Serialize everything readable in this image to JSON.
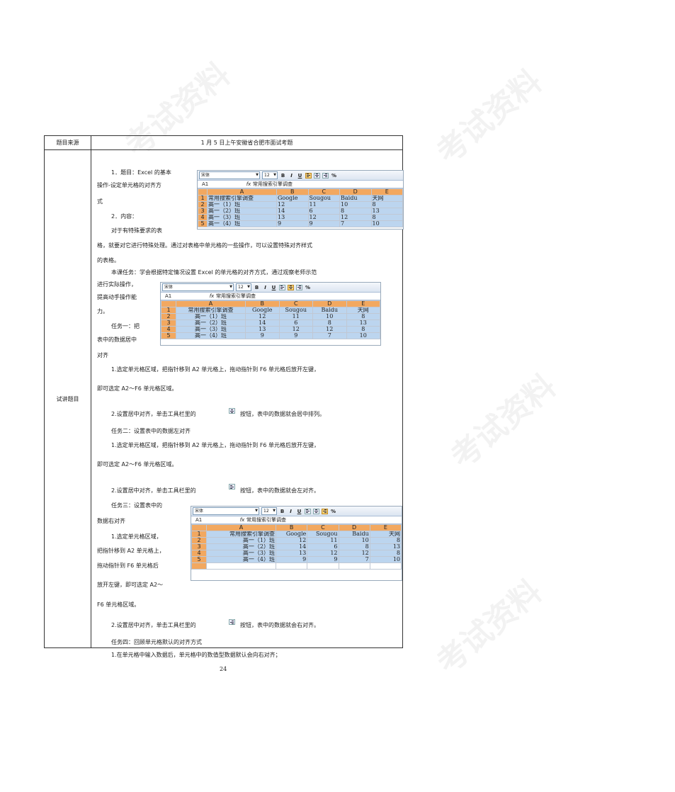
{
  "header": {
    "label": "题目来源",
    "value": "1 月 5 日上午安徽省合肥市面试考题"
  },
  "left_label": "试讲题目",
  "lines": [
    "1．题目：Excel 的基本",
    "操作-设定单元格的对齐方",
    "式",
    "2．内容：",
    "对于有特殊要求的表",
    "格，就要对它进行特殊处理。通过对表格中单元格的一些操作，可以设置特殊对齐样式",
    "的表格。",
    "本课任务：学会根据特定情况设置 Excel 的单元格的对齐方式，通过观察老师示范",
    "进行实际操作，",
    "提高动手操作能",
    "力。",
    "任务一：把",
    "表中的数据居中",
    "对齐",
    "1.选定单元格区域，把指针移到 A2 单元格上，拖动指针到 F6 单元格后放开左键，",
    "即可选定 A2～F6 单元格区域。",
    "2.设置居中对齐，单击工具栏里的",
    "按钮，表中的数据就会居中排列。",
    "任务二：设置表中的数据左对齐",
    "1.选定单元格区域，把指针移到 A2 单元格上，拖动指针到 F6 单元格后放开左键，",
    "即可选定 A2～F6 单元格区域。",
    "2.设置居中对齐，单击工具栏里的",
    "按钮，表中的数据就会左对齐。",
    "任务三：设置表中的",
    "数据右对齐",
    "1.选定单元格区域，",
    "把指针移到 A2 单元格上，",
    "拖动指针到 F6 单元格后",
    "放开左键，即可选定 A2～",
    "F6 单元格区域。",
    "2.设置居中对齐，单击工具栏里的",
    "按钮，表中的数据就会右对齐。",
    "任务四：回顾单元格默认的对齐方式",
    "1.在单元格中输入数据后，单元格中的数值型数据默认会向右对齐；"
  ],
  "excel": {
    "font": "宋体",
    "size": "12",
    "namebox": "A1",
    "fx": "fx",
    "formula": "常用搜索引擎调查",
    "bold": "B",
    "italic": "I",
    "underline": "U",
    "percent": "%",
    "cols": [
      "A",
      "B",
      "C",
      "D",
      "E"
    ],
    "header_row": [
      "常用搜索引擎调查",
      "Google",
      "Sougou",
      "Baidu",
      "天网"
    ],
    "rows": [
      [
        "高一（1）班",
        "12",
        "11",
        "10",
        "8"
      ],
      [
        "高一（2）班",
        "14",
        "6",
        "8",
        "13"
      ],
      [
        "高一（3）班",
        "13",
        "12",
        "12",
        "8"
      ],
      [
        "高一（4）班",
        "9",
        "9",
        "7",
        "10"
      ]
    ],
    "row_nums": [
      "1",
      "2",
      "3",
      "4",
      "5"
    ]
  },
  "page_number": "24",
  "watermark": "考试资料"
}
